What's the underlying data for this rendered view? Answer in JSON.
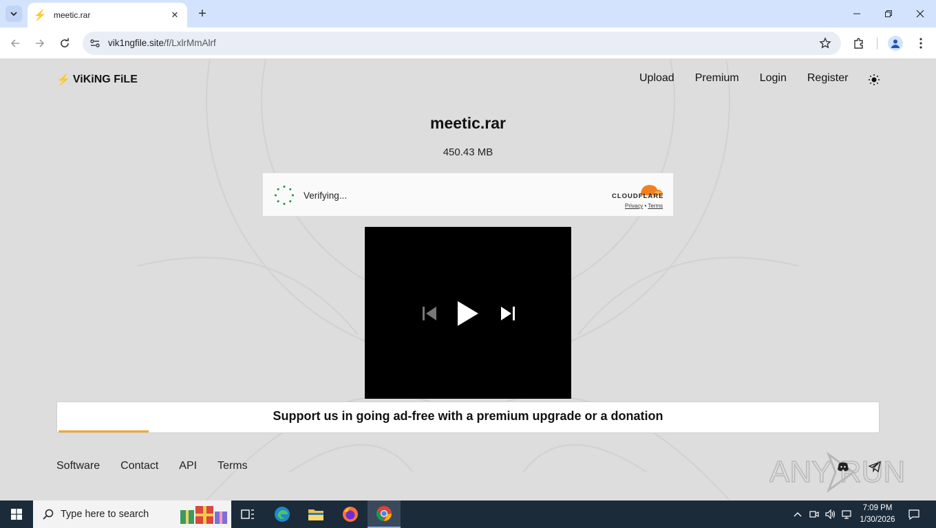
{
  "browser": {
    "tab": {
      "title": "meetic.rar",
      "favicon": "lightning-bolt-icon"
    },
    "url": {
      "host": "vik1ngfile.site",
      "path": "/f/LxlrMmAlrf"
    }
  },
  "site": {
    "brand": "ViKiNG FiLE",
    "nav": [
      "Upload",
      "Premium",
      "Login",
      "Register"
    ]
  },
  "file": {
    "name": "meetic.rar",
    "size": "450.43 MB"
  },
  "captcha": {
    "status": "Verifying...",
    "provider": "CLOUDFLARE",
    "privacy": "Privacy",
    "terms": "Terms",
    "separator": "•"
  },
  "support": {
    "text": "Support us in going ad-free with a premium upgrade or a donation",
    "progress": 0.11
  },
  "footer": {
    "links": [
      "Software",
      "Contact",
      "API",
      "Terms"
    ]
  },
  "watermark": "ANY RUN",
  "taskbar": {
    "search_placeholder": "Type here to search",
    "time": "7:09 PM",
    "date": "1/30/2026"
  },
  "colors": {
    "accent": "#f0a830",
    "cloudflare_orange": "#f38020",
    "page_bg": "#dddddd",
    "taskbar_bg": "#1c2b3a"
  }
}
